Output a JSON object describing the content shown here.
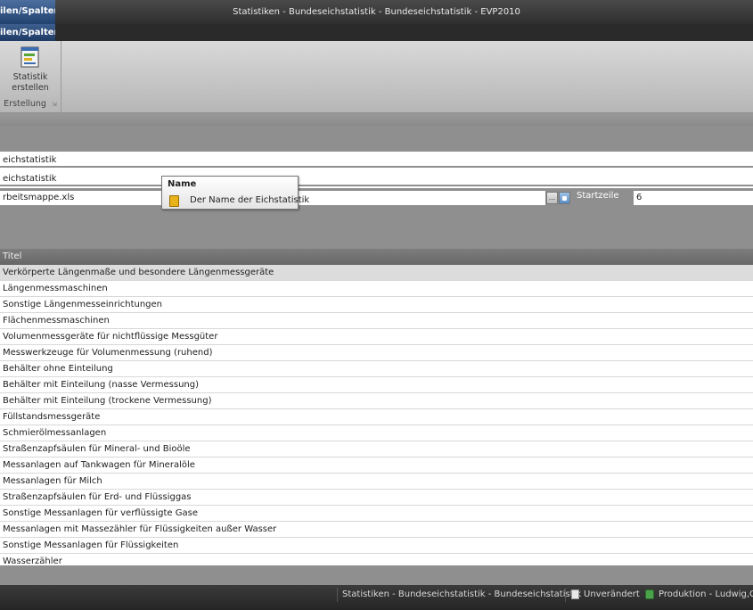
{
  "window": {
    "title": "Statistiken - Bundeseichstatistik - Bundeseichstatistik - EVP2010",
    "active_tab": "ilen/Spalten",
    "sub_tab": "ilen/Spalten"
  },
  "ribbon": {
    "button_label_1": "Statistik",
    "button_label_2": "erstellen",
    "group_label": "Erstellung",
    "group_launcher": "⇲"
  },
  "form": {
    "field1": "eichstatistik",
    "field2": "eichstatistik",
    "file": "rbeitsmappe.xls",
    "browse": "...",
    "start_label": "Startzeile",
    "start_value": "6"
  },
  "tooltip": {
    "title": "Name",
    "text": "Der Name der Eichstatistik"
  },
  "table": {
    "header": "Titel",
    "rows": [
      "Verkörperte Längenmaße und besondere Längenmessgeräte",
      "Längenmessmaschinen",
      "Sonstige Längenmesseinrichtungen",
      "Flächenmessmaschinen",
      "Volumenmessgeräte für nichtflüssige Messgüter",
      "Messwerkzeuge für Volumenmessung  (ruhend)",
      "Behälter ohne Einteilung",
      "Behälter mit Einteilung (nasse Vermessung)",
      "Behälter mit Einteilung (trockene Vermessung)",
      "Füllstandsmessgeräte",
      "Schmierölmessanlagen",
      "Straßenzapfsäulen für Mineral- und Bioöle",
      "Messanlagen auf Tankwagen für Mineralöle",
      "Messanlagen für Milch",
      "Straßenzapfsäulen für Erd- und Flüssiggas",
      "Sonstige Messanlagen für verflüssigte Gase",
      "Messanlagen mit Massezähler für Flüssigkeiten außer Wasser",
      "Sonstige Messanlagen für Flüssigkeiten",
      "Wasserzähler"
    ]
  },
  "status": {
    "path": "Statistiken - Bundeseichstatistik - Bundeseichstatistik",
    "state": "Unverändert",
    "env": "Produktion - Ludwig,Gü"
  }
}
